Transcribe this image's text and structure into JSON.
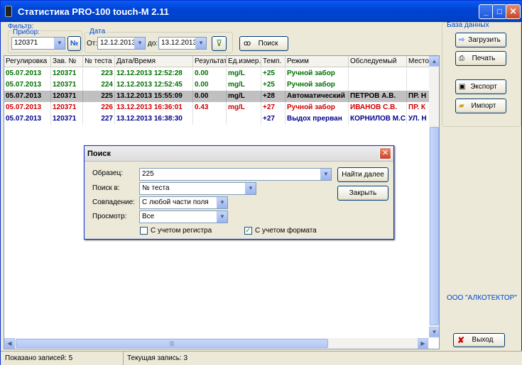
{
  "window": {
    "title": "Статистика PRO-100 touch-M 2.11"
  },
  "filter": {
    "label": "Фильтр:",
    "device_label": "Прибор:",
    "device_value": "120371",
    "device_btn": "№",
    "date_label": "Дата",
    "from_label": "От:",
    "from_value": "12.12.2013",
    "to_label": "до:",
    "to_value": "13.12.2013",
    "search_btn": "Поиск"
  },
  "grid": {
    "headers": [
      "Регулировка",
      "Зав. №",
      "№ теста",
      "Дата/Время",
      "Результат",
      "Ед.измер.",
      "Темп.",
      "Режим",
      "Обследуемый",
      "Место"
    ],
    "rows": [
      {
        "cells": [
          "05.07.2013",
          "120371",
          "223",
          "12.12.2013 12:52:28",
          "0.00",
          "mg/L",
          "+25",
          "Ручной забор",
          "",
          ""
        ],
        "color": "#007000",
        "selected": false
      },
      {
        "cells": [
          "05.07.2013",
          "120371",
          "224",
          "12.12.2013 12:52:45",
          "0.00",
          "mg/L",
          "+25",
          "Ручной забор",
          "",
          ""
        ],
        "color": "#007000",
        "selected": false
      },
      {
        "cells": [
          "05.07.2013",
          "120371",
          "225",
          "13.12.2013 15:55:09",
          "0.00",
          "mg/L",
          "+28",
          "Автоматический",
          "ПЕТРОВ А.В.",
          "ПР. Н"
        ],
        "color": "#000000",
        "selected": true
      },
      {
        "cells": [
          "05.07.2013",
          "120371",
          "226",
          "13.12.2013 16:36:01",
          "0.43",
          "mg/L",
          "+27",
          "Ручной забор",
          "ИВАНОВ С.В.",
          "ПР. К"
        ],
        "color": "#d00000",
        "selected": false
      },
      {
        "cells": [
          "05.07.2013",
          "120371",
          "227",
          "13.12.2013 16:38:30",
          "",
          "",
          "+27",
          "Выдох прерван",
          "КОРНИЛОВ М.С.",
          "УЛ. Н"
        ],
        "color": "#00008b",
        "selected": false
      }
    ]
  },
  "dialog": {
    "title": "Поиск",
    "sample_label": "Образец:",
    "sample_value": "225",
    "search_in_label": "Поиск в:",
    "search_in_value": "№ теста",
    "match_label": "Совпадение:",
    "match_value": "С любой части поля",
    "view_label": "Просмотр:",
    "view_value": "Все",
    "case_label": "С учетом регистра",
    "format_label": "С учетом формата",
    "find_next": "Найти далее",
    "close": "Закрыть"
  },
  "db": {
    "label": "База данных",
    "load": "Загрузить",
    "print": "Печать",
    "export": "Экспорт",
    "import": "Импорт"
  },
  "company": "ООО \"АЛКОТЕКТОР\"",
  "exit": "Выход",
  "status": {
    "shown": "Показано записей: 5",
    "current": "Текущая запись: 3"
  }
}
